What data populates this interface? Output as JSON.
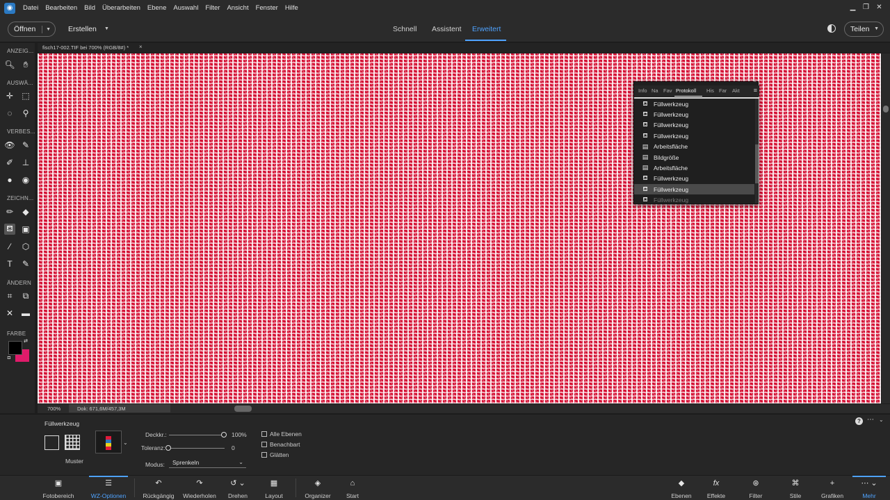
{
  "menu": {
    "items": [
      "Datei",
      "Bearbeiten",
      "Bild",
      "Überarbeiten",
      "Ebene",
      "Auswahl",
      "Filter",
      "Ansicht",
      "Fenster",
      "Hilfe"
    ]
  },
  "header": {
    "open_label": "Öffnen",
    "create_label": "Erstellen",
    "modes": [
      "Schnell",
      "Assistent",
      "Erweitert"
    ],
    "active_mode": "Erweitert",
    "share_label": "Teilen"
  },
  "toolbar": {
    "sections": [
      "ANZEIG...",
      "AUSWÄ...",
      "VERBES...",
      "ZEICHN...",
      "ÄNDERN",
      "FARBE"
    ]
  },
  "document": {
    "tab_label": "fisch17-002.TIF bei 700% (RGB/8#) *",
    "zoom": "700%",
    "doc_size": "Dok: 671,6M/457,3M"
  },
  "history_panel": {
    "tabs": [
      "Info",
      "Na",
      "Fav",
      "Protokoll",
      "His",
      "Far",
      "Akt"
    ],
    "active_tab": "Protokoll",
    "items": [
      {
        "label": "Füllwerkzeug",
        "icon": "fill-icon"
      },
      {
        "label": "Füllwerkzeug",
        "icon": "fill-icon"
      },
      {
        "label": "Füllwerkzeug",
        "icon": "fill-icon"
      },
      {
        "label": "Füllwerkzeug",
        "icon": "fill-icon"
      },
      {
        "label": "Arbeitsfläche",
        "icon": "document-icon"
      },
      {
        "label": "Bildgröße",
        "icon": "document-icon"
      },
      {
        "label": "Arbeitsfläche",
        "icon": "document-icon"
      },
      {
        "label": "Füllwerkzeug",
        "icon": "fill-icon"
      },
      {
        "label": "Füllwerkzeug",
        "icon": "fill-icon"
      },
      {
        "label": "Füllwerkzeug",
        "icon": "fill-icon"
      }
    ],
    "selected_index": 8
  },
  "options": {
    "title": "Füllwerkzeug",
    "pattern_label": "Muster",
    "opacity_label": "Deckkr.:",
    "opacity_value": "100%",
    "opacity": 1.0,
    "tolerance_label": "Toleranz:",
    "tolerance_value": "0",
    "tolerance": 0,
    "mode_label": "Modus:",
    "mode_value": "Sprenkeln",
    "checkboxes": [
      "Alle Ebenen",
      "Benachbart",
      "Glätten"
    ]
  },
  "taskbar": {
    "left": [
      {
        "label": "Fotobereich",
        "icon": "photo-bin-icon"
      },
      {
        "label": "WZ-Optionen",
        "icon": "tool-options-icon"
      },
      {
        "label": "Rückgängig",
        "icon": "undo-icon"
      },
      {
        "label": "Wiederholen",
        "icon": "redo-icon"
      },
      {
        "label": "Drehen",
        "icon": "rotate-icon"
      },
      {
        "label": "Layout",
        "icon": "layout-icon"
      },
      {
        "label": "Organizer",
        "icon": "organizer-icon"
      },
      {
        "label": "Start",
        "icon": "home-icon"
      }
    ],
    "right": [
      {
        "label": "Ebenen",
        "icon": "layers-icon"
      },
      {
        "label": "Effekte",
        "icon": "effects-icon"
      },
      {
        "label": "Filter",
        "icon": "filter-icon"
      },
      {
        "label": "Stile",
        "icon": "styles-icon"
      },
      {
        "label": "Grafiken",
        "icon": "graphics-icon"
      },
      {
        "label": "Mehr",
        "icon": "more-icon"
      }
    ],
    "active": [
      "WZ-Optionen",
      "Mehr"
    ]
  },
  "colors": {
    "accent": "#4fa3ff",
    "foreground": "#000000",
    "background": "#e01b6a",
    "canvas_red": "#d41034"
  }
}
